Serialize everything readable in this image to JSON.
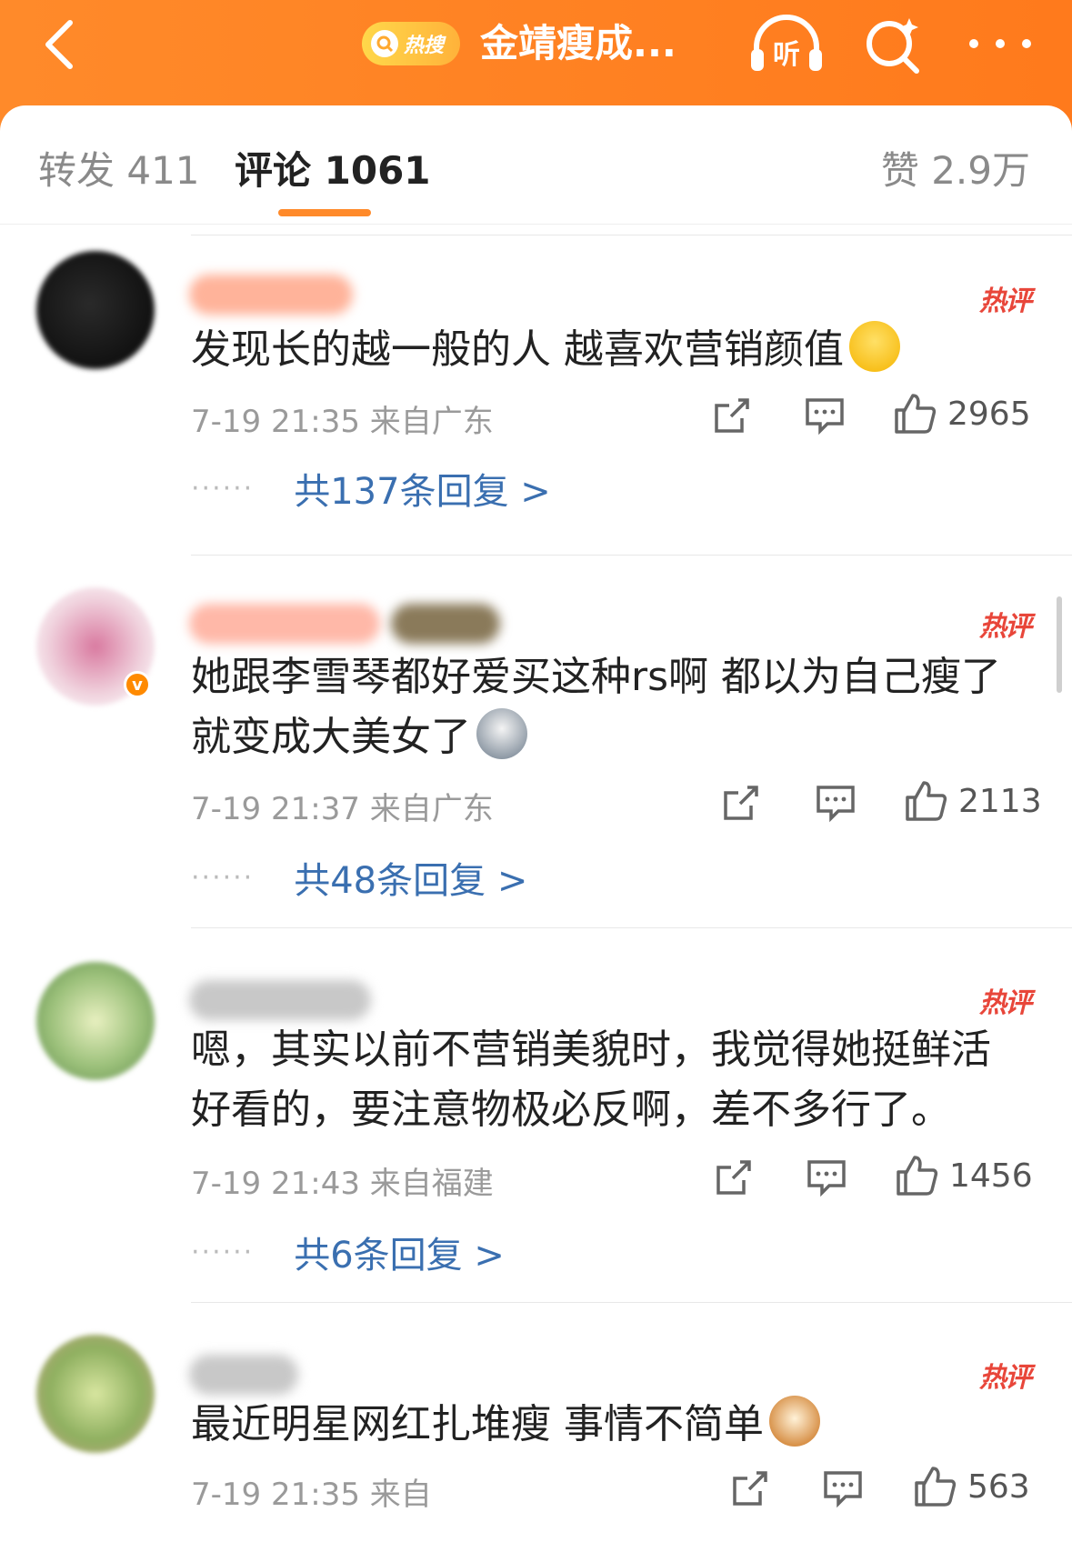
{
  "header": {
    "hot_label": "热搜",
    "title": "金靖瘦成..."
  },
  "tabs": [
    {
      "label": "转发 411"
    },
    {
      "label": "评论 1061"
    },
    {
      "label": "赞 2.9万"
    }
  ],
  "comments": [
    {
      "hot_tag": "热评",
      "text": "发现长的越一般的人 越喜欢营销颜值",
      "emoji": "smile-emoji",
      "time": "7-19 21:35",
      "location": "来自广东",
      "likes": "2965",
      "replies": "共137条回复 >"
    },
    {
      "hot_tag": "热评",
      "text": "她跟李雪琴都好爱买这种rs啊 都以为自己瘦了就变成大美女了",
      "emoji": "husky-emoji",
      "time": "7-19 21:37",
      "location": "来自广东",
      "likes": "2113",
      "replies": "共48条回复 >"
    },
    {
      "hot_tag": "热评",
      "text": "嗯，其实以前不营销美貌时，我觉得她挺鲜活好看的，要注意物极必反啊，差不多行了。",
      "time": "7-19 21:43",
      "location": "来自福建",
      "likes": "1456",
      "replies": "共6条回复 >"
    },
    {
      "hot_tag": "热评",
      "text": "最近明星网红扎堆瘦 事情不简单",
      "emoji": "cat-emoji",
      "time": "7-19 21:35",
      "location": "来自",
      "likes": "563"
    }
  ],
  "colors": {
    "brand_orange": "#ff8a2a",
    "hot_red": "#e8463a",
    "link_blue": "#3a6fb0"
  }
}
